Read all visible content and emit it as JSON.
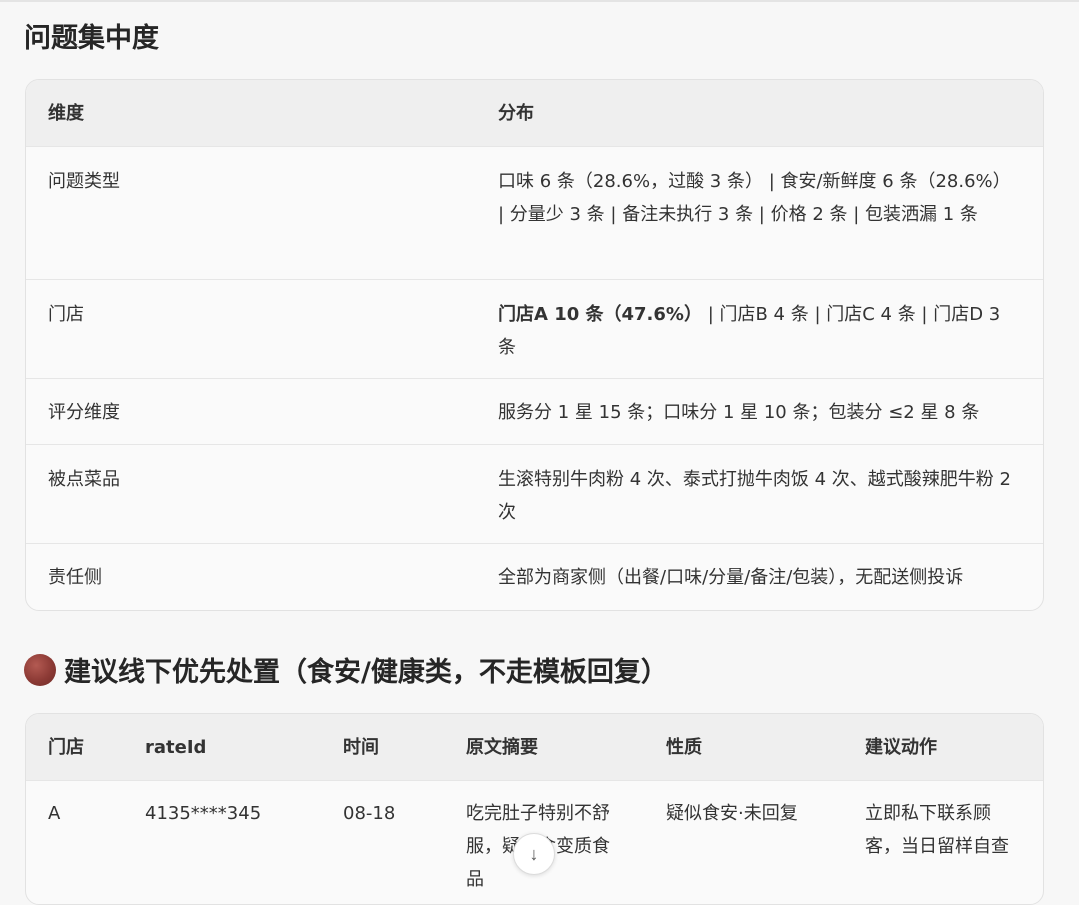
{
  "section1": {
    "title": "问题集中度",
    "headers": {
      "dimension": "维度",
      "distribution": "分布"
    },
    "rows": [
      {
        "dimension": "问题类型",
        "distribution": "口味 6 条（28.6%，过酸 3 条） | 食安/新鲜度 6 条（28.6%） | 分量少 3 条 | 备注未执行 3 条 | 价格 2 条 | 包装洒漏 1 条"
      },
      {
        "dimension": "门店",
        "distribution_bold": "门店A 10 条（47.6%）",
        "distribution": " | 门店B 4 条 | 门店C 4 条 | 门店D 3 条"
      },
      {
        "dimension": "评分维度",
        "distribution": "服务分 1 星 15 条；口味分 1 星 10 条；包装分 ≤2 星 8 条"
      },
      {
        "dimension": "被点菜品",
        "distribution": "生滚特别牛肉粉 4 次、泰式打抛牛肉饭 4 次、越式酸辣肥牛粉 2 次"
      },
      {
        "dimension": "责任侧",
        "distribution": "全部为商家侧（出餐/口味/分量/备注/包装），无配送侧投诉"
      }
    ]
  },
  "section2": {
    "title": "建议线下优先处置（食安/健康类，不走模板回复）",
    "headers": {
      "store": "门店",
      "rateid": "rateId",
      "time": "时间",
      "summary": "原文摘要",
      "nature": "性质",
      "action": "建议动作"
    },
    "rows": [
      {
        "store": "A",
        "rateid": "4135****345",
        "time": "08-18",
        "summary": "吃完肚子特别不舒服，疑似食变质食品",
        "nature": "疑似食安·未回复",
        "action": "立即私下联系顾客，当日留样自查"
      }
    ]
  },
  "colors": {
    "accent_dot": "#8c3a35",
    "header_bg": "#efefef",
    "card_bg": "#fafafa"
  },
  "icons": {
    "scroll_down": "arrow-down-icon"
  }
}
